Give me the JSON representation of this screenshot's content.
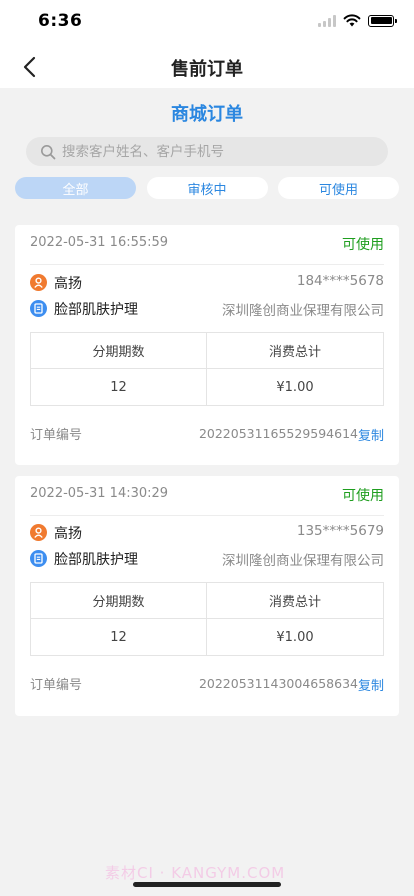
{
  "status_bar": {
    "time": "6:36"
  },
  "nav": {
    "title": "售前订单"
  },
  "section": {
    "title": "商城订单"
  },
  "search": {
    "placeholder": "搜索客户姓名、客户手机号"
  },
  "tabs": [
    {
      "label": "全部",
      "active": true
    },
    {
      "label": "审核中",
      "active": false
    },
    {
      "label": "可使用",
      "active": false
    }
  ],
  "orders": [
    {
      "time": "2022-05-31 16:55:59",
      "status": "可使用",
      "customer_name": "高扬",
      "phone": "184****5678",
      "product": "脸部肌肤护理",
      "company": "深圳隆创商业保理有限公司",
      "table_headers": [
        "分期期数",
        "消费总计"
      ],
      "installments": "12",
      "total": "¥1.00",
      "order_no_label": "订单编号",
      "order_no": "20220531165529594614",
      "copy_label": "复制"
    },
    {
      "time": "2022-05-31 14:30:29",
      "status": "可使用",
      "customer_name": "高扬",
      "phone": "135****5679",
      "product": "脸部肌肤护理",
      "company": "深圳隆创商业保理有限公司",
      "table_headers": [
        "分期期数",
        "消费总计"
      ],
      "installments": "12",
      "total": "¥1.00",
      "order_no_label": "订单编号",
      "order_no": "20220531143004658634",
      "copy_label": "复制"
    }
  ],
  "watermark": "素材CI · KANGYM.COM",
  "colors": {
    "accent": "#2b87e0",
    "status_green": "#1f9e1f",
    "person_icon": "#f07a30",
    "doc_icon": "#3d8ef0"
  }
}
